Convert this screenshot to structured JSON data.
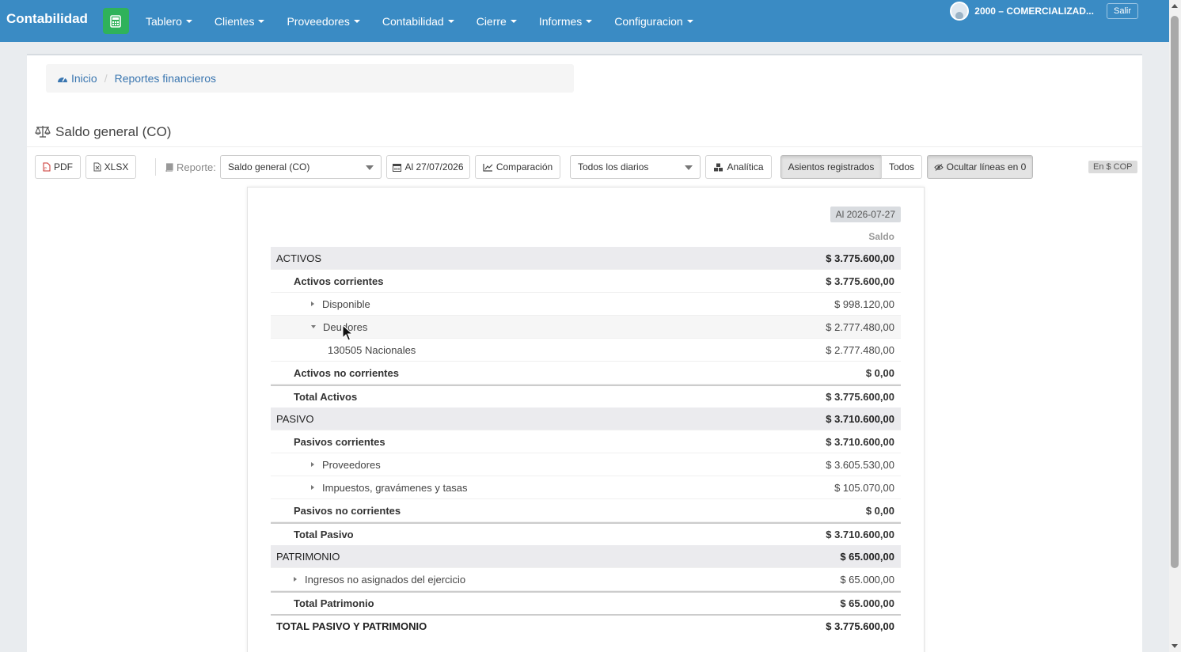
{
  "navbar": {
    "brand": "Contabilidad",
    "menu": [
      {
        "label": "Tablero"
      },
      {
        "label": "Clientes"
      },
      {
        "label": "Proveedores"
      },
      {
        "label": "Contabilidad"
      },
      {
        "label": "Cierre"
      },
      {
        "label": "Informes"
      },
      {
        "label": "Configuracion"
      }
    ],
    "company": "2000 – COMERCIALIZAD...",
    "logout": "Salir"
  },
  "breadcrumb": {
    "home": "Inicio",
    "current": "Reportes financieros"
  },
  "page": {
    "title": "Saldo general (CO)"
  },
  "toolbar": {
    "pdf": "PDF",
    "xlsx": "XLSX",
    "report_label": "Reporte:",
    "report_select": "Saldo general (CO)",
    "date_button": "Al 27/07/2026",
    "comparison": "Comparación",
    "journals_select": "Todos los diarios",
    "analytic": "Analítica",
    "posted": "Asientos registrados",
    "all": "Todos",
    "hide_zero": "Ocultar líneas en 0",
    "currency": "En $ COP"
  },
  "report": {
    "date_header": "Al 2026-07-27",
    "column_header": "Saldo",
    "rows": [
      {
        "label": "ACTIVOS",
        "amount": "$ 3.775.600,00"
      },
      {
        "label": "Activos corrientes",
        "amount": "$ 3.775.600,00"
      },
      {
        "label": "Disponible",
        "amount": "$ 998.120,00"
      },
      {
        "label": "Deudores",
        "amount": "$ 2.777.480,00"
      },
      {
        "label": "130505 Nacionales",
        "amount": "$ 2.777.480,00"
      },
      {
        "label": "Activos no corrientes",
        "amount": "$ 0,00"
      },
      {
        "label": "Total Activos",
        "amount": "$ 3.775.600,00"
      },
      {
        "label": "PASIVO",
        "amount": "$ 3.710.600,00"
      },
      {
        "label": "Pasivos corrientes",
        "amount": "$ 3.710.600,00"
      },
      {
        "label": "Proveedores",
        "amount": "$ 3.605.530,00"
      },
      {
        "label": "Impuestos, gravámenes y tasas",
        "amount": "$ 105.070,00"
      },
      {
        "label": "Pasivos no corrientes",
        "amount": "$ 0,00"
      },
      {
        "label": "Total Pasivo",
        "amount": "$ 3.710.600,00"
      },
      {
        "label": "PATRIMONIO",
        "amount": "$ 65.000,00"
      },
      {
        "label": "Ingresos no asignados del ejercicio",
        "amount": "$ 65.000,00"
      },
      {
        "label": "Total Patrimonio",
        "amount": "$ 65.000,00"
      },
      {
        "label": "TOTAL PASIVO Y PATRIMONIO",
        "amount": "$ 3.775.600,00"
      }
    ]
  }
}
